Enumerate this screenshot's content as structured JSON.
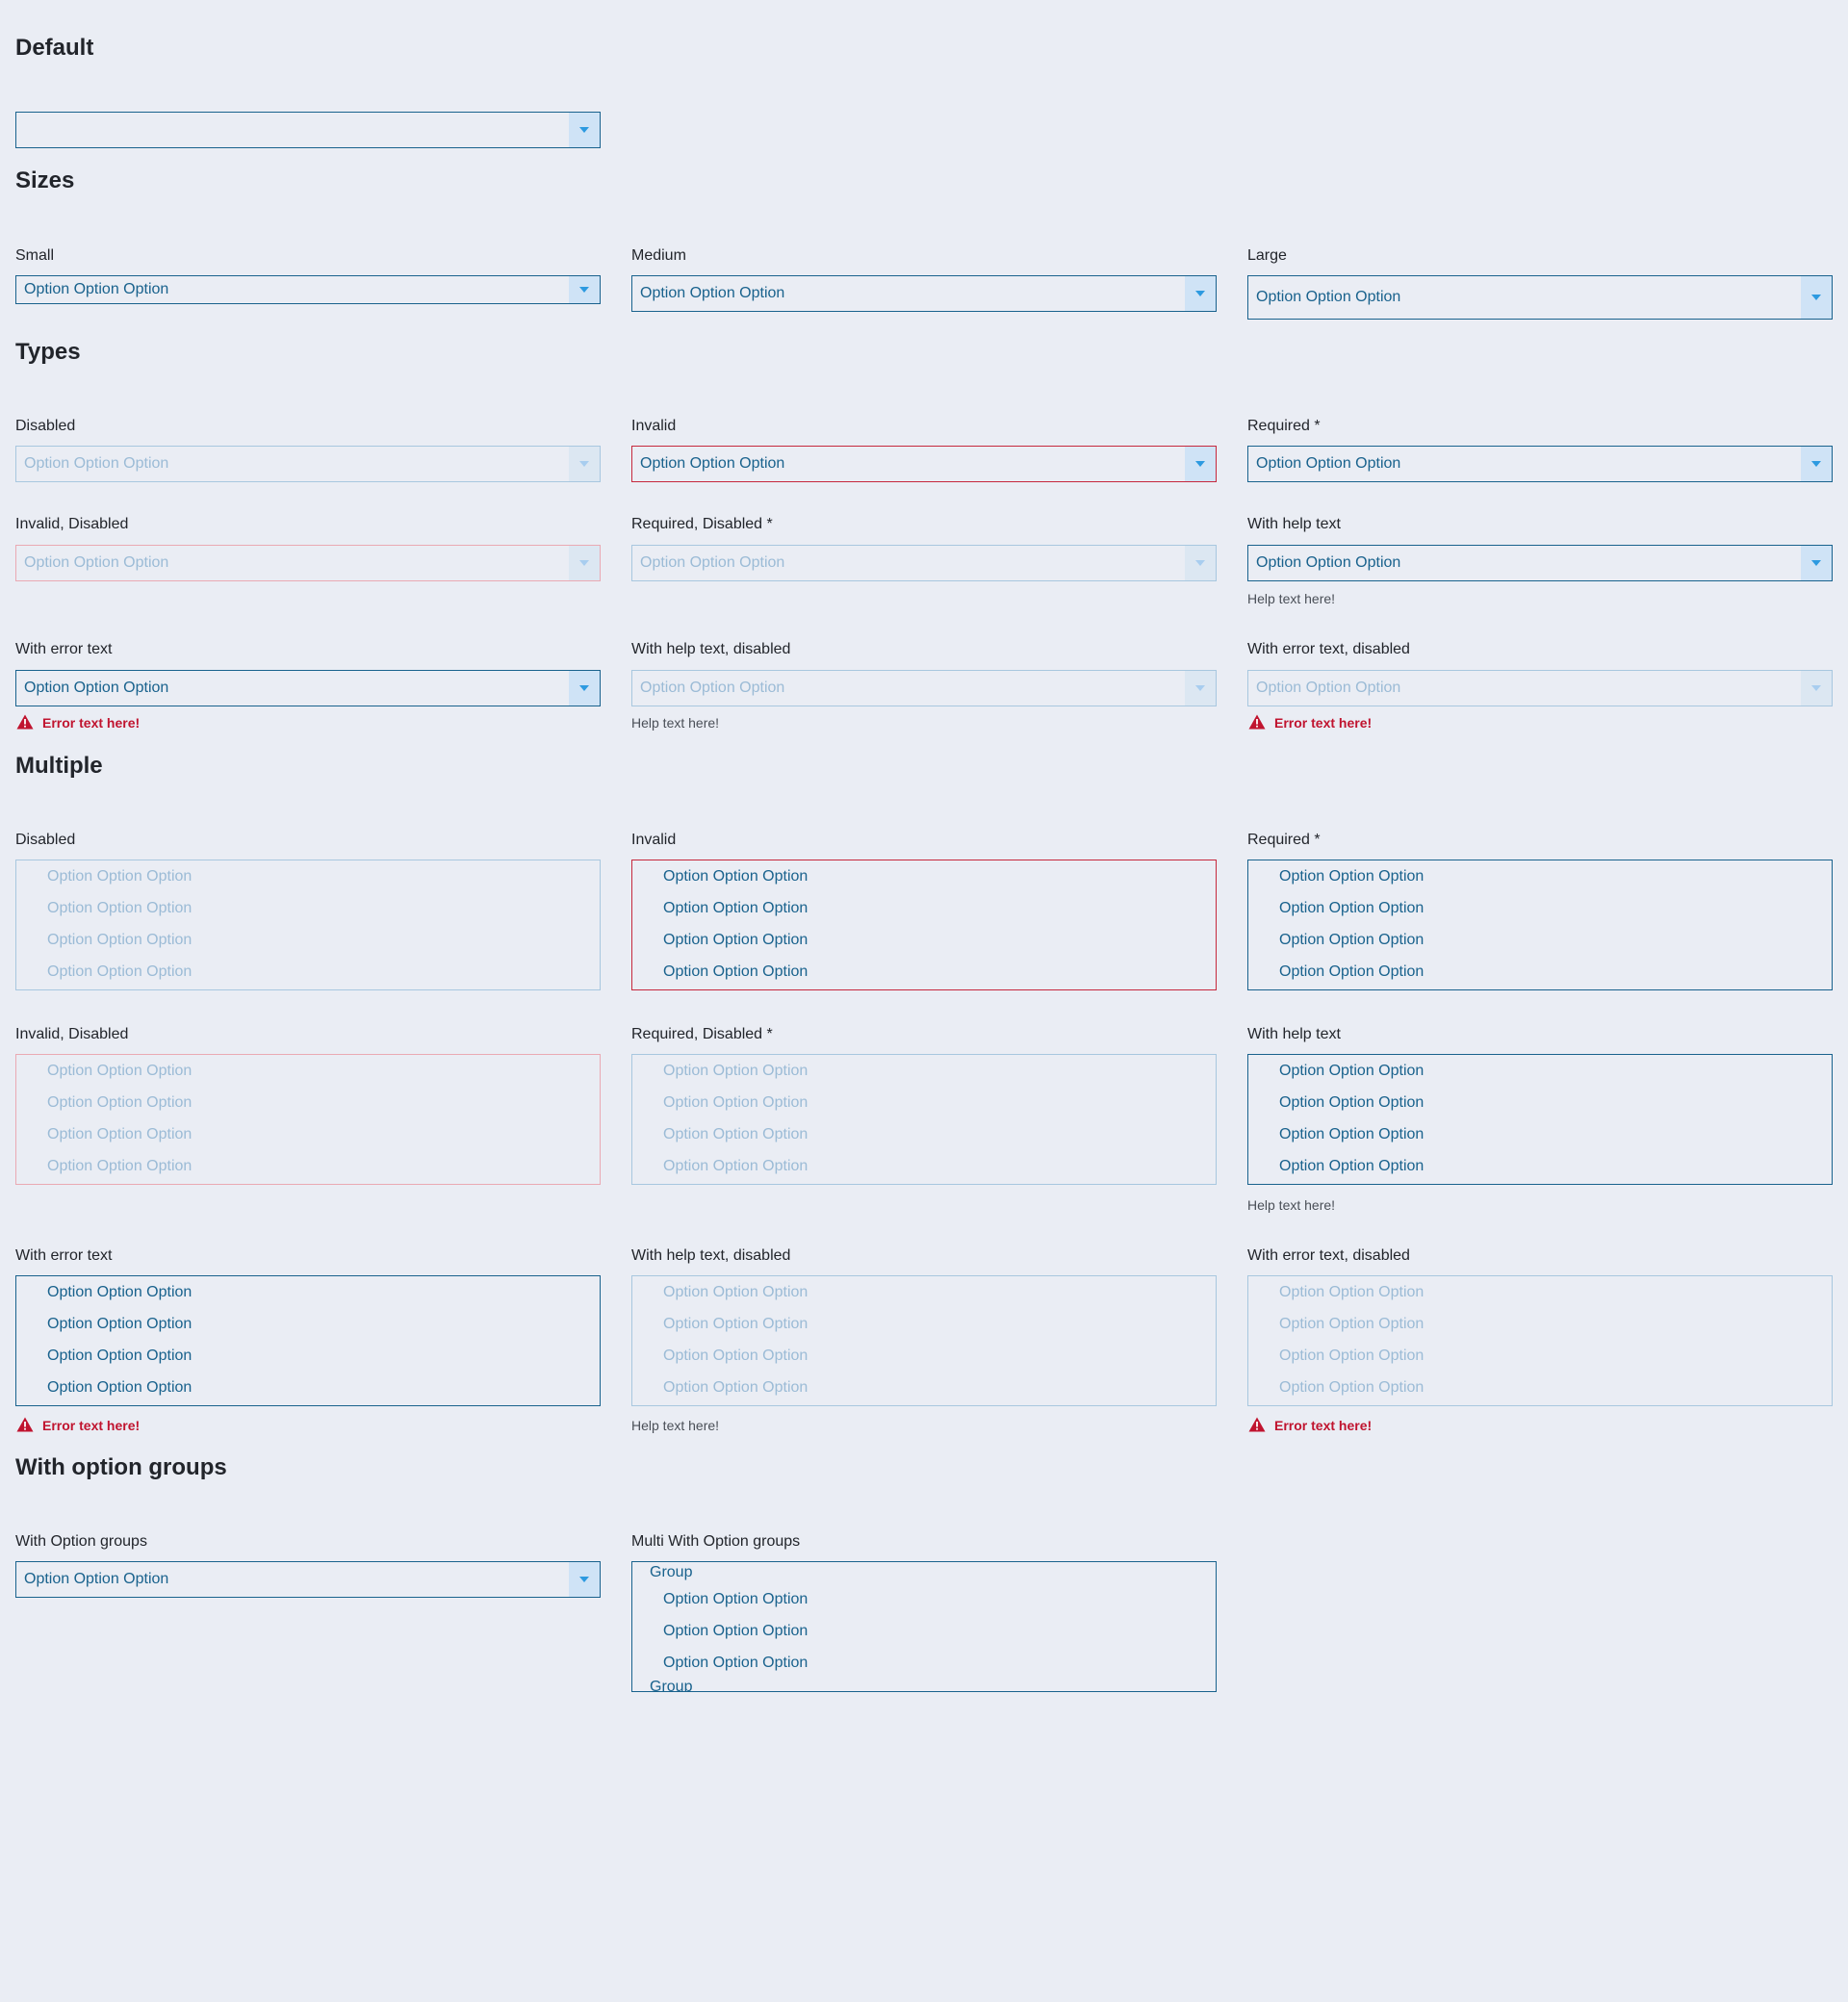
{
  "sections": {
    "default": "Default",
    "sizes": "Sizes",
    "types": "Types",
    "multiple": "Multiple",
    "groups": "With option groups"
  },
  "labels": {
    "small": "Small",
    "medium": "Medium",
    "large": "Large",
    "disabled": "Disabled",
    "invalid": "Invalid",
    "required": "Required *",
    "invalid_disabled": "Invalid, Disabled",
    "required_disabled": "Required, Disabled *",
    "with_help": "With help text",
    "with_error": "With error text",
    "help_disabled": "With help text, disabled",
    "error_disabled": "With error text, disabled",
    "with_groups": "With Option groups",
    "multi_groups": "Multi With Option groups"
  },
  "option": "Option Option Option",
  "group_label": "Group",
  "help_text": "Help text here!",
  "error_text": "Error text here!",
  "colors": {
    "background": "#eaedf4",
    "accent": "#19628d",
    "arrow_bg": "#cfe3f6",
    "error": "#c6283d"
  },
  "icons": {
    "dropdown": "chevron-down-icon",
    "error": "warning-triangle-icon"
  }
}
